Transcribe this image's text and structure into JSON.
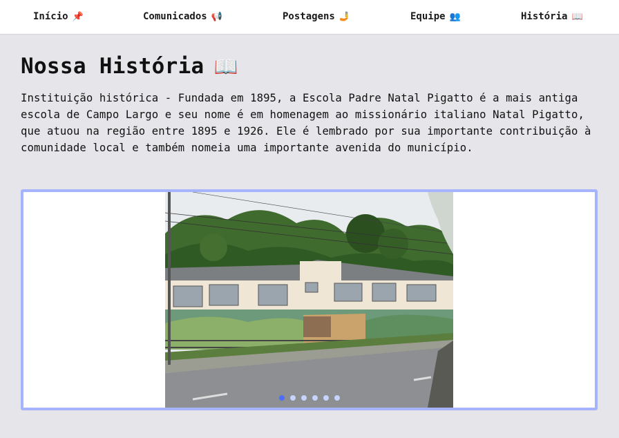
{
  "nav": {
    "items": [
      {
        "label": "Início",
        "emoji": "📌"
      },
      {
        "label": "Comunicados",
        "emoji": "📢"
      },
      {
        "label": "Postagens",
        "emoji": "🤳"
      },
      {
        "label": "Equipe",
        "emoji": "👥"
      },
      {
        "label": "História",
        "emoji": "📖"
      }
    ]
  },
  "page": {
    "title": "Nossa História",
    "title_emoji": "📖",
    "description": "Instituição histórica - Fundada em 1895, a Escola Padre Natal Pigatto é a mais antiga escola de Campo Largo e seu nome é em homenagem ao missionário italiano Natal Pigatto, que atuou na região entre 1895 e 1926. Ele é lembrado por sua importante contribuição à comunidade local e também nomeia uma importante avenida do município."
  },
  "carousel": {
    "slide_count": 6,
    "active_index": 0,
    "accent": "#4f6ef7",
    "border": "#a5b4fc"
  }
}
